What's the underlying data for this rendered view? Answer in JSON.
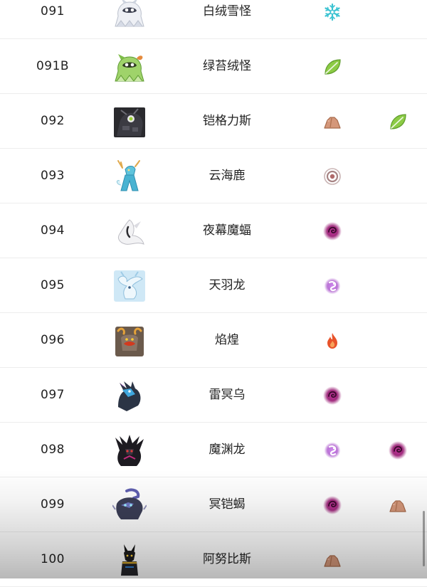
{
  "rows": [
    {
      "num": "091",
      "name": "白绒雪怪",
      "sprite": "pale-fluffy-yeti-sprite",
      "types": [
        "ice-icon"
      ]
    },
    {
      "num": "091B",
      "name": "绿苔绒怪",
      "sprite": "green-mossy-yeti-sprite",
      "types": [
        "grass-icon"
      ]
    },
    {
      "num": "092",
      "name": "铠格力斯",
      "sprite": "dark-armored-beast-sprite",
      "types": [
        "ground-icon",
        "grass-icon"
      ]
    },
    {
      "num": "093",
      "name": "云海鹿",
      "sprite": "cyan-cloud-deer-sprite",
      "types": [
        "normal-icon"
      ]
    },
    {
      "num": "094",
      "name": "夜幕魔蝠",
      "sprite": "white-night-bat-sprite",
      "types": [
        "dark-icon"
      ]
    },
    {
      "num": "095",
      "name": "天羽龙",
      "sprite": "light-blue-dragon-sprite",
      "types": [
        "dragon-icon"
      ]
    },
    {
      "num": "096",
      "name": "焰煌",
      "sprite": "horned-fire-beast-sprite",
      "types": [
        "fire-icon"
      ]
    },
    {
      "num": "097",
      "name": "雷冥乌",
      "sprite": "thunder-crow-sprite",
      "types": [
        "dark-icon"
      ]
    },
    {
      "num": "098",
      "name": "魔渊龙",
      "sprite": "black-abyss-dragon-sprite",
      "types": [
        "dragon-icon",
        "dark-icon"
      ]
    },
    {
      "num": "099",
      "name": "冥铠蝎",
      "sprite": "armored-scorpion-sprite",
      "types": [
        "dark-icon",
        "ground-icon"
      ]
    },
    {
      "num": "100",
      "name": "阿努比斯",
      "sprite": "jackal-anubis-sprite",
      "types": [
        "ground-icon"
      ]
    }
  ],
  "type_colors": {
    "ice": "#3cc3d2",
    "grass": "#7cc241",
    "ground": "#c98a68",
    "normal": "#b59a9a",
    "dark": "#a1287f",
    "dragon": "#b264d0",
    "fire": "#e8532a"
  }
}
